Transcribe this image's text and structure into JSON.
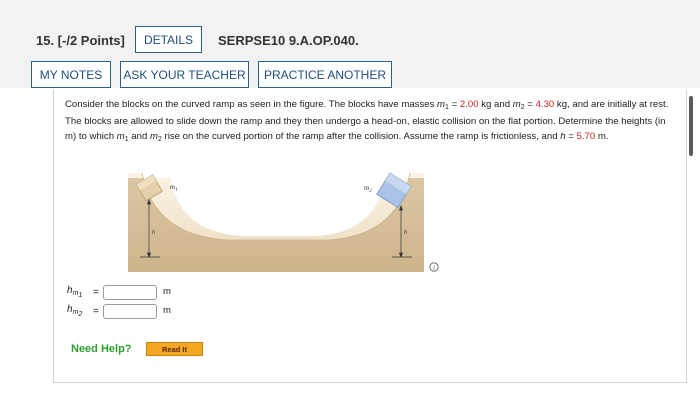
{
  "question": {
    "number_label": "15. [-/2 Points]",
    "details_label": "DETAILS",
    "code": "SERPSE10 9.A.OP.040."
  },
  "toolbar": {
    "my_notes": "MY NOTES",
    "ask_teacher": "ASK YOUR TEACHER",
    "practice_another": "PRACTICE ANOTHER"
  },
  "problem": {
    "p1": "Consider the blocks on the curved ramp as seen in the figure. The blocks have masses ",
    "m1_sym": "m",
    "m1_sub": "1",
    "p2": " = ",
    "m1_value": "2.00",
    "p3": " kg and ",
    "m2_sym": "m",
    "m2_sub": "2",
    "p4": " = ",
    "m2_value": "4.30",
    "p5": " kg, and are initially at rest. The blocks are allowed to slide down the ramp and they then undergo a head-on, elastic collision on the flat portion. Determine the heights (in m) to which ",
    "m1b_sym": "m",
    "m1b_sub": "1",
    "p6": " and ",
    "m2b_sym": "m",
    "m2b_sub": "2",
    "p7": " rise on the curved portion of the ramp after the collision. Assume the ramp is frictionless, and ",
    "h_sym": "h",
    "p8": " = ",
    "h_value": "5.70",
    "p9": " m."
  },
  "figure": {
    "label_m1": "m",
    "label_m1_sub": "1",
    "label_m2": "m",
    "label_m2_sub": "2",
    "label_h": "h"
  },
  "answers": [
    {
      "label": "h",
      "sub_sym": "m",
      "sub_sub": "1",
      "eq": "=",
      "value": "",
      "unit": "m"
    },
    {
      "label": "h",
      "sub_sym": "m",
      "sub_sub": "2",
      "eq": "=",
      "value": "",
      "unit": "m"
    }
  ],
  "help": {
    "need_help": "Need Help?",
    "read_it": "Read It"
  },
  "colors": {
    "button_border": "#2f5f8f",
    "red_value": "#d01f1f",
    "need_help": "#2e9e2e",
    "read_it_bg": "#f5a623"
  },
  "icons": {
    "info": "info-circle-icon"
  }
}
